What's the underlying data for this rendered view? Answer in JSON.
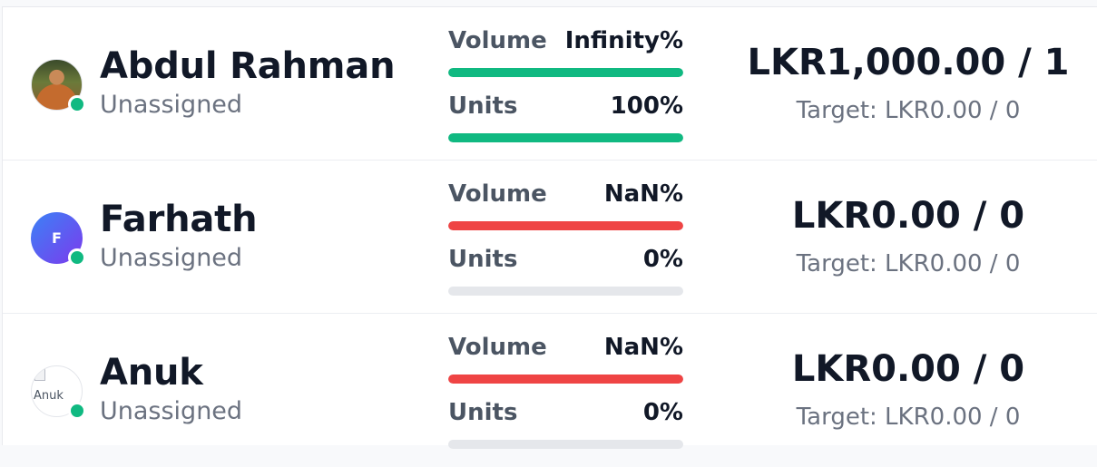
{
  "colors": {
    "online": "#10b981",
    "bar_good": "#10b981",
    "bar_bad": "#ef4444",
    "bar_track": "#e5e7eb"
  },
  "rows": [
    {
      "name": "Abdul Rahman",
      "role": "Unassigned",
      "avatar": "photo",
      "volume_label": "Volume",
      "volume_value": "Infinity%",
      "volume_fill": 1,
      "volume_color": "#10b981",
      "units_label": "Units",
      "units_value": "100%",
      "units_fill": 1,
      "units_color": "#10b981",
      "total": "LKR1,000.00 / 1",
      "target": "Target: LKR0.00 / 0"
    },
    {
      "name": "Farhath",
      "role": "Unassigned",
      "avatar": "initial",
      "avatar_initial": "F",
      "volume_label": "Volume",
      "volume_value": "NaN%",
      "volume_fill": 1,
      "volume_color": "#ef4444",
      "units_label": "Units",
      "units_value": "0%",
      "units_fill": 0,
      "units_color": "#10b981",
      "total": "LKR0.00 / 0",
      "target": "Target: LKR0.00 / 0"
    },
    {
      "name": "Anuk",
      "role": "Unassigned",
      "avatar": "broken",
      "avatar_alt": "Anuk",
      "volume_label": "Volume",
      "volume_value": "NaN%",
      "volume_fill": 1,
      "volume_color": "#ef4444",
      "units_label": "Units",
      "units_value": "0%",
      "units_fill": 0,
      "units_color": "#10b981",
      "total": "LKR0.00 / 0",
      "target": "Target: LKR0.00 / 0"
    }
  ]
}
